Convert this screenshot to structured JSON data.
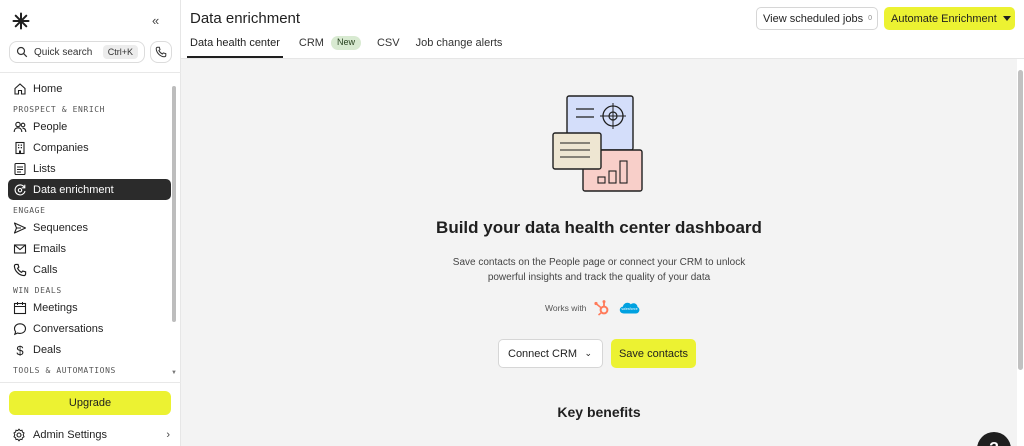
{
  "sidebar": {
    "search": {
      "label": "Quick search",
      "shortcut": "Ctrl+K"
    },
    "items": [
      {
        "type": "item",
        "label": "Home",
        "icon": "home-icon"
      },
      {
        "type": "section",
        "label": "PROSPECT & ENRICH"
      },
      {
        "type": "item",
        "label": "People",
        "icon": "people-icon"
      },
      {
        "type": "item",
        "label": "Companies",
        "icon": "building-icon"
      },
      {
        "type": "item",
        "label": "Lists",
        "icon": "list-icon"
      },
      {
        "type": "item",
        "label": "Data enrichment",
        "icon": "enrichment-icon",
        "active": true
      },
      {
        "type": "section",
        "label": "ENGAGE"
      },
      {
        "type": "item",
        "label": "Sequences",
        "icon": "send-icon"
      },
      {
        "type": "item",
        "label": "Emails",
        "icon": "mail-icon"
      },
      {
        "type": "item",
        "label": "Calls",
        "icon": "phone-icon"
      },
      {
        "type": "section",
        "label": "WIN DEALS"
      },
      {
        "type": "item",
        "label": "Meetings",
        "icon": "calendar-icon"
      },
      {
        "type": "item",
        "label": "Conversations",
        "icon": "chat-icon"
      },
      {
        "type": "item",
        "label": "Deals",
        "icon": "dollar-icon"
      },
      {
        "type": "section",
        "label": "TOOLS & AUTOMATIONS"
      }
    ],
    "upgrade_label": "Upgrade",
    "admin_label": "Admin Settings"
  },
  "header": {
    "title": "Data enrichment",
    "tabs": [
      {
        "label": "Data health center",
        "active": true
      },
      {
        "label": "CRM",
        "badge": "New"
      },
      {
        "label": "CSV"
      },
      {
        "label": "Job change alerts"
      }
    ],
    "view_scheduled_label": "View scheduled jobs",
    "view_scheduled_count": "0",
    "automate_label": "Automate Enrichment"
  },
  "main": {
    "heading": "Build your data health center dashboard",
    "description": "Save contacts on the People page or connect your CRM to unlock powerful insights and track the quality of your data",
    "works_with_label": "Works with",
    "integrations": [
      "hubspot-icon",
      "salesforce-icon"
    ],
    "connect_crm_label": "Connect CRM",
    "save_contacts_label": "Save contacts",
    "key_benefits_label": "Key benefits"
  },
  "colors": {
    "accent": "#ecf232",
    "active_nav": "#2b2b2b",
    "hubspot": "#ff7a59",
    "salesforce": "#00a1e0"
  }
}
